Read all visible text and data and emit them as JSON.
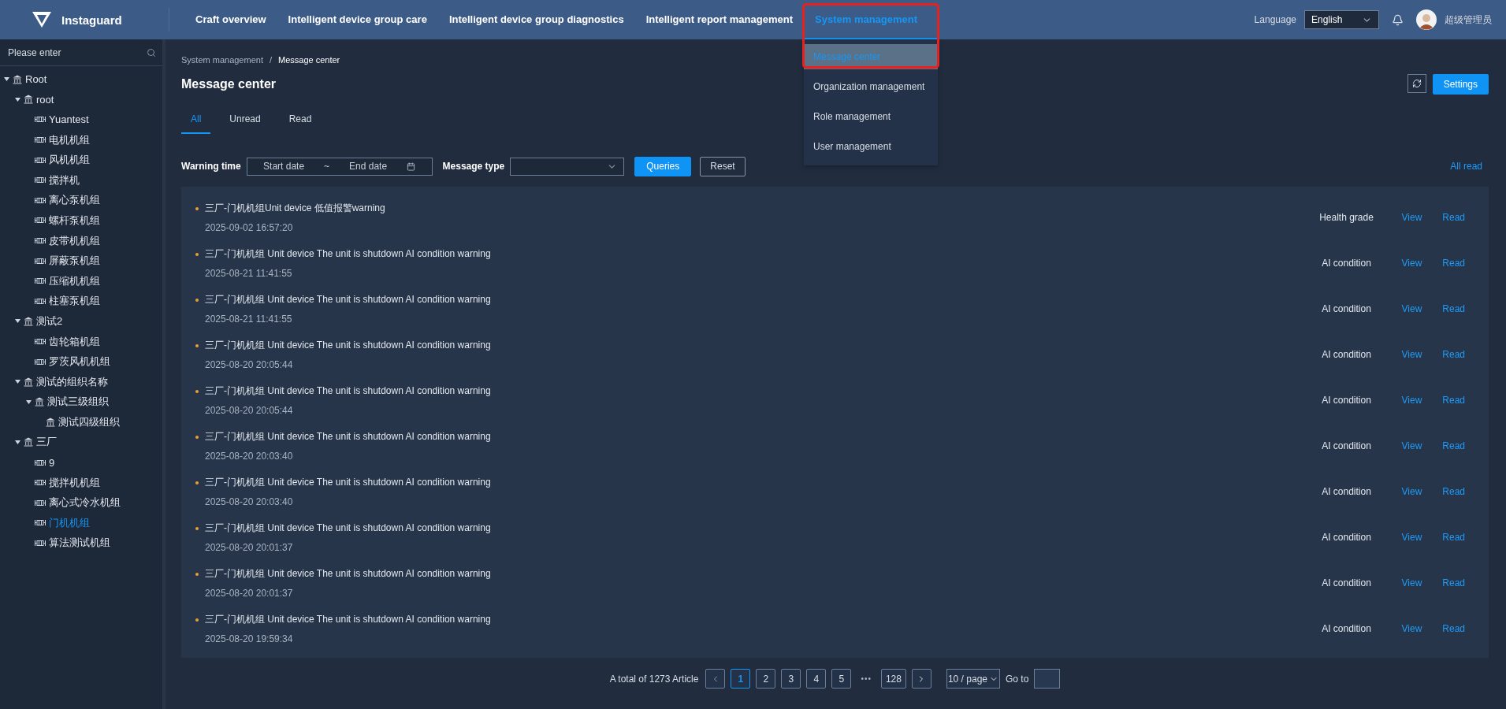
{
  "header": {
    "brand": "Instaguard",
    "nav": [
      {
        "label": "Craft overview",
        "selected": false
      },
      {
        "label": "Intelligent device group care",
        "selected": false
      },
      {
        "label": "Intelligent device group diagnostics",
        "selected": false
      },
      {
        "label": "Intelligent report management",
        "selected": false
      },
      {
        "label": "System management",
        "selected": true
      }
    ],
    "menu": {
      "highlighted": true,
      "items": [
        {
          "label": "Message center",
          "selected": true
        },
        {
          "label": "Organization management",
          "selected": false
        },
        {
          "label": "Role management",
          "selected": false
        },
        {
          "label": "User management",
          "selected": false
        }
      ]
    },
    "language_label": "Language",
    "language": "English",
    "user": "超级管理员"
  },
  "sidebar": {
    "search": {
      "placeholder": "Please enter"
    },
    "tree": [
      {
        "label": "Root",
        "kind": "org",
        "expanded": true,
        "selected": false,
        "children": [
          {
            "label": "root",
            "kind": "org",
            "expanded": true,
            "selected": false,
            "children": [
              {
                "label": "Yuantest",
                "kind": "device",
                "selected": false
              },
              {
                "label": "电机机组",
                "kind": "device",
                "selected": false
              },
              {
                "label": "风机机组",
                "kind": "device",
                "selected": false
              },
              {
                "label": "搅拌机",
                "kind": "device",
                "selected": false
              },
              {
                "label": "离心泵机组",
                "kind": "device",
                "selected": false
              },
              {
                "label": "螺杆泵机组",
                "kind": "device",
                "selected": false
              },
              {
                "label": "皮带机机组",
                "kind": "device",
                "selected": false
              },
              {
                "label": "屏蔽泵机组",
                "kind": "device",
                "selected": false
              },
              {
                "label": "压缩机机组",
                "kind": "device",
                "selected": false
              },
              {
                "label": "柱塞泵机组",
                "kind": "device",
                "selected": false
              }
            ]
          },
          {
            "label": "测试2",
            "kind": "org",
            "expanded": true,
            "selected": false,
            "children": [
              {
                "label": "齿轮箱机组",
                "kind": "device",
                "selected": false
              },
              {
                "label": "罗茨风机机组",
                "kind": "device",
                "selected": false
              }
            ]
          },
          {
            "label": "测试的组织名称",
            "kind": "org",
            "expanded": true,
            "selected": false,
            "children": [
              {
                "label": "测试三级组织",
                "kind": "org",
                "expanded": true,
                "selected": false,
                "children": [
                  {
                    "label": "测试四级组织",
                    "kind": "org",
                    "selected": false
                  }
                ]
              }
            ]
          },
          {
            "label": "三厂",
            "kind": "org",
            "expanded": true,
            "selected": false,
            "children": [
              {
                "label": "9",
                "kind": "device",
                "selected": false
              },
              {
                "label": "搅拌机机组",
                "kind": "device",
                "selected": false
              },
              {
                "label": "离心式冷水机组",
                "kind": "device",
                "selected": false
              },
              {
                "label": "门机机组",
                "kind": "device",
                "selected": true
              },
              {
                "label": "算法测试机组",
                "kind": "device",
                "selected": false
              }
            ]
          }
        ]
      }
    ]
  },
  "breadcrumb": {
    "separator": "/",
    "items": [
      "System management",
      "Message center"
    ]
  },
  "title": "Message center",
  "settings_button": "Settings",
  "tabs": [
    {
      "label": "All",
      "selected": true
    },
    {
      "label": "Unread",
      "selected": false
    },
    {
      "label": "Read",
      "selected": false
    }
  ],
  "filters": {
    "warning_time_label": "Warning time",
    "start_placeholder": "Start date",
    "separator": "~",
    "end_placeholder": "End date",
    "message_type_label": "Message type",
    "query_button": "Queries",
    "reset_button": "Reset",
    "all_read": "All read"
  },
  "messages": [
    {
      "title": "三厂-门机机组Unit device 低值报警warning",
      "time": "2025-09-02 16:57:20",
      "type": "Health grade",
      "view": "View",
      "read": "Read"
    },
    {
      "title": "三厂-门机机组 Unit device The unit is shutdown AI condition warning",
      "time": "2025-08-21 11:41:55",
      "type": "AI condition",
      "view": "View",
      "read": "Read"
    },
    {
      "title": "三厂-门机机组 Unit device The unit is shutdown AI condition warning",
      "time": "2025-08-21 11:41:55",
      "type": "AI condition",
      "view": "View",
      "read": "Read"
    },
    {
      "title": "三厂-门机机组 Unit device The unit is shutdown AI condition warning",
      "time": "2025-08-20 20:05:44",
      "type": "AI condition",
      "view": "View",
      "read": "Read"
    },
    {
      "title": "三厂-门机机组 Unit device The unit is shutdown AI condition warning",
      "time": "2025-08-20 20:05:44",
      "type": "AI condition",
      "view": "View",
      "read": "Read"
    },
    {
      "title": "三厂-门机机组 Unit device The unit is shutdown AI condition warning",
      "time": "2025-08-20 20:03:40",
      "type": "AI condition",
      "view": "View",
      "read": "Read"
    },
    {
      "title": "三厂-门机机组 Unit device The unit is shutdown AI condition warning",
      "time": "2025-08-20 20:03:40",
      "type": "AI condition",
      "view": "View",
      "read": "Read"
    },
    {
      "title": "三厂-门机机组 Unit device The unit is shutdown AI condition warning",
      "time": "2025-08-20 20:01:37",
      "type": "AI condition",
      "view": "View",
      "read": "Read"
    },
    {
      "title": "三厂-门机机组 Unit device The unit is shutdown AI condition warning",
      "time": "2025-08-20 20:01:37",
      "type": "AI condition",
      "view": "View",
      "read": "Read"
    },
    {
      "title": "三厂-门机机组 Unit device The unit is shutdown AI condition warning",
      "time": "2025-08-20 19:59:34",
      "type": "AI condition",
      "view": "View",
      "read": "Read"
    }
  ],
  "pagination": {
    "total": "A total of 1273 Article",
    "pages": [
      {
        "label": "1",
        "kind": "page",
        "selected": true
      },
      {
        "label": "2",
        "kind": "page",
        "selected": false
      },
      {
        "label": "3",
        "kind": "page",
        "selected": false
      },
      {
        "label": "4",
        "kind": "page",
        "selected": false
      },
      {
        "label": "5",
        "kind": "page",
        "selected": false
      },
      {
        "label": "•••",
        "kind": "ellipsis"
      },
      {
        "label": "128",
        "kind": "page",
        "selected": false
      }
    ],
    "page_size": "10 / page",
    "goto_label": "Go to"
  }
}
